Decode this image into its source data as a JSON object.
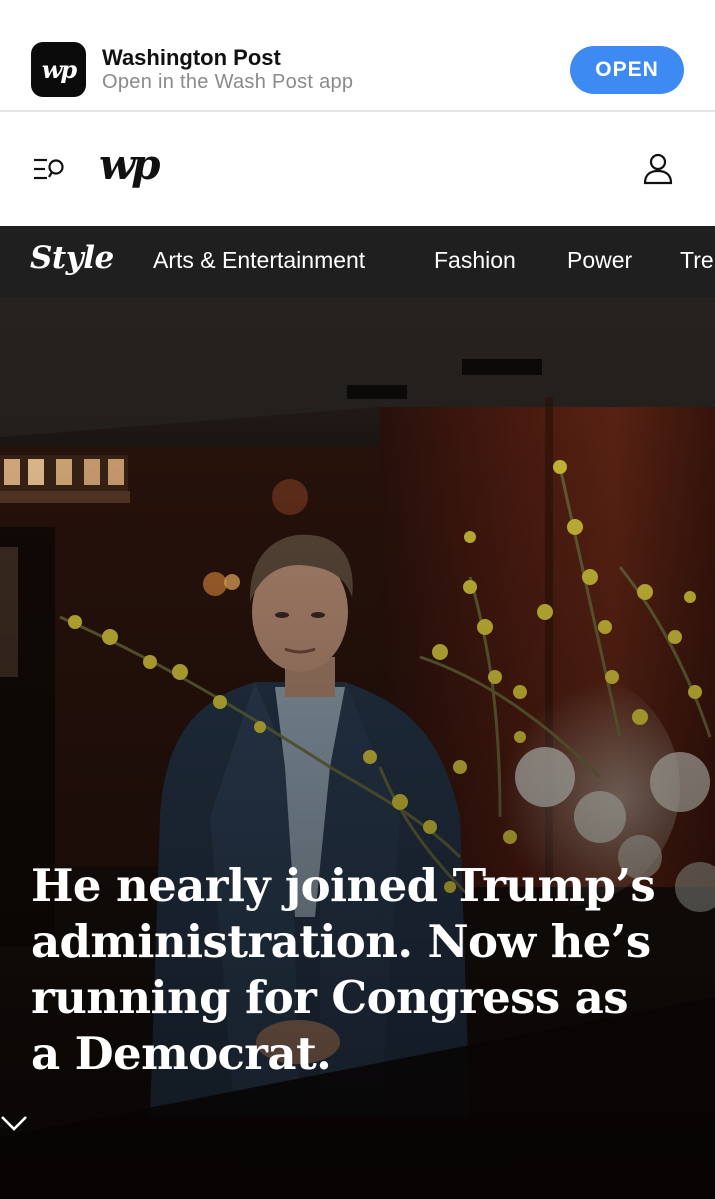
{
  "app_banner": {
    "app_name": "Washington Post",
    "subtitle": "Open in the Wash Post app",
    "open_label": "OPEN",
    "icon_text": "wp",
    "accent_color": "#3d8bf2"
  },
  "header": {
    "logo_text": "wp",
    "menu_icon": "menu-search-icon",
    "account_icon": "account-icon"
  },
  "section_nav": {
    "section_title": "Style",
    "items": [
      "Arts & Entertainment",
      "Fashion",
      "Power",
      "Tre"
    ]
  },
  "hero": {
    "headline": "He nearly joined Trump’s administration. Now he’s running for Congress as a Democrat.",
    "chevron_icon": "chevron-down-icon"
  }
}
